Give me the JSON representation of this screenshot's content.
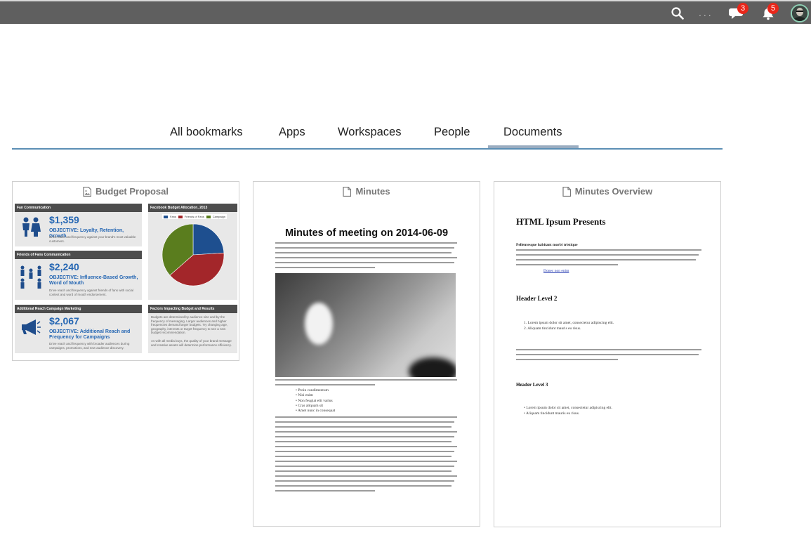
{
  "topbar": {
    "search_icon": "search-icon",
    "more_label": "...",
    "chat_icon": "chat-icon",
    "chat_count": "3",
    "notification_icon": "bell-icon",
    "notification_count": "5",
    "avatar_icon": "user-avatar"
  },
  "tabs": [
    {
      "label": "All bookmarks"
    },
    {
      "label": "Apps"
    },
    {
      "label": "Workspaces"
    },
    {
      "label": "People"
    },
    {
      "label": "Documents",
      "active": true
    }
  ],
  "cards": [
    {
      "title": "Budget Proposal",
      "icon": "image-file-icon",
      "preview": {
        "panels": [
          {
            "head": "Fan Communication",
            "value": "$1,359",
            "objective": "OBJECTIVE: Loyalty, Retention, Growth",
            "text": "Drive reach and frequency against your brand's most valuable customers."
          },
          {
            "head": "Friends of Fans Communication",
            "value": "$2,240",
            "objective": "OBJECTIVE: Influence-Based Growth, Word of Mouth",
            "text": "Drive reach and frequency against friends of fans with social context and word of mouth endorsement."
          },
          {
            "head": "Additional Reach Campaign Marketing",
            "value": "$2,067",
            "objective": "OBJECTIVE: Additional Reach and Frequency for Campaigns",
            "text": "Drive reach and frequency with broader audiences during campaigns, promotions, and new audience discovery."
          }
        ],
        "chart_panel": {
          "head": "Facebook Budget Allocation, 2013",
          "legend": [
            "Fans",
            "Friends of Fans",
            "Campaign"
          ]
        },
        "factors_panel": {
          "head": "Factors Impacting Budget and Results",
          "text": "Budgets are determined by audience size and by the frequency of messaging. Larger audiences and higher frequencies demand larger budgets. Try changing age, geography, interests or target frequency to see a new budget recommendation.",
          "text2": "As with all media buys, the quality of your brand message and creative assets will determine performance efficiency."
        }
      }
    },
    {
      "title": "Minutes",
      "icon": "document-icon",
      "preview": {
        "heading": "Minutes of meeting on 2014-06-09",
        "list": [
          "Proin condimentum",
          "Nisi enim",
          "Non feugiat elit varius",
          "Cras aliquam sit",
          "Amet nunc in consequat"
        ]
      }
    },
    {
      "title": "Minutes Overview",
      "icon": "document-icon",
      "preview": {
        "heading": "HTML Ipsum Presents",
        "lead": "Pellentesque habitant morbi tristique",
        "link": "Donec non enim",
        "h2": "Header Level 2",
        "ol": [
          "Lorem ipsum dolor sit amet, consectetur adipiscing elit.",
          "Aliquam tincidunt mauris eu risus."
        ],
        "h3": "Header Level 3",
        "ul": [
          "Lorem ipsum dolor sit amet, consectetur adipiscing elit.",
          "Aliquam tincidunt mauris eu risus."
        ]
      }
    }
  ],
  "colors": {
    "topbar": "#5f5f5f",
    "badge": "#e8261a",
    "tab_line": "#5b8fb5",
    "active_underline": "#9aacc0",
    "chart_blue": "#1e4f8f",
    "chart_red": "#a3262a",
    "chart_green": "#5a7d1e"
  },
  "chart_data": {
    "type": "pie",
    "title": "Facebook Budget Allocation, 2013",
    "categories": [
      "Fans",
      "Friends of Fans",
      "Campaign"
    ],
    "values": [
      1359,
      2240,
      2067
    ]
  }
}
